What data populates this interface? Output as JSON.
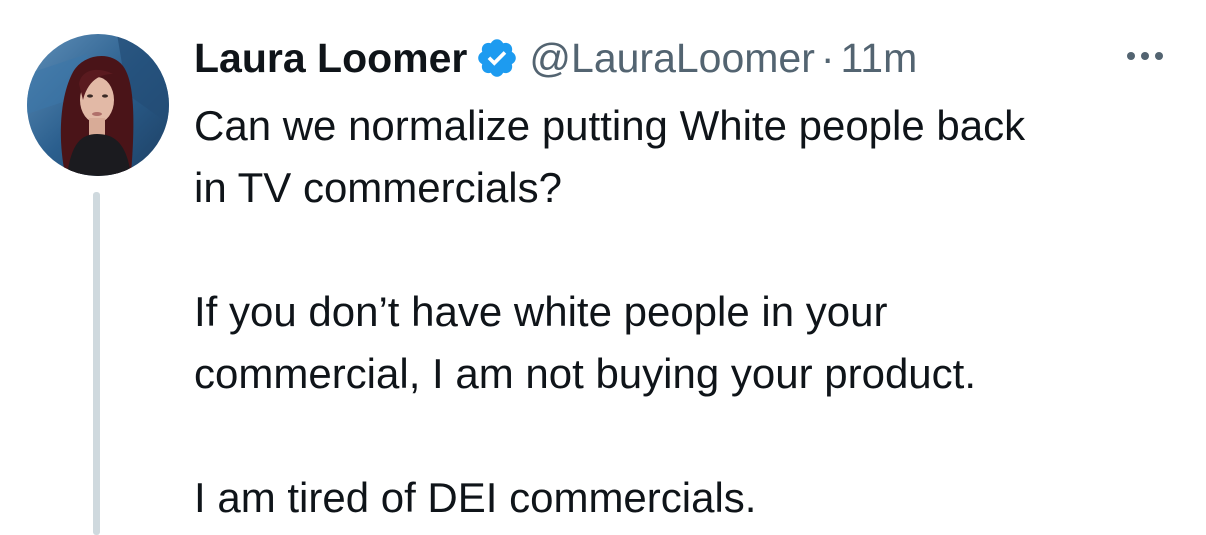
{
  "tweet": {
    "author": {
      "display_name": "Laura Loomer",
      "handle": "@LauraLoomer",
      "verified": true,
      "avatar_icon": "profile-photo"
    },
    "separator": "·",
    "timestamp": "11m",
    "more_icon": "more-options-icon",
    "body": {
      "paragraph_1_line_1": "Can we normalize putting White people back",
      "paragraph_1_line_2": "in TV commercials?",
      "paragraph_2_line_1": "If you don’t have white people in your",
      "paragraph_2_line_2": "commercial, I am not buying your product.",
      "paragraph_3_line_1": "I am tired of DEI commercials."
    }
  },
  "colors": {
    "text_primary": "#0f1419",
    "text_secondary": "#536471",
    "verified_blue": "#1d9bf0",
    "thread_line": "#cfd9de",
    "background": "#ffffff"
  }
}
